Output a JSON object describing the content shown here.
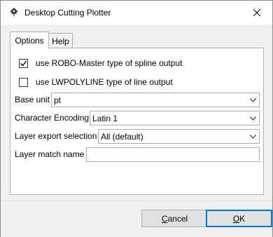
{
  "window": {
    "title": "Desktop Cutting Plotter"
  },
  "tabs": [
    {
      "label": "Options",
      "active": true
    },
    {
      "label": "Help",
      "active": false
    }
  ],
  "options": {
    "robo_master": {
      "label": "use ROBO-Master type of spline output",
      "checked": true
    },
    "lwpolyline": {
      "label": "use LWPOLYLINE type of line output",
      "checked": false
    },
    "base_unit": {
      "label": "Base unit",
      "value": "pt"
    },
    "character_encoding": {
      "label": "Character Encoding",
      "value": "Latin 1"
    },
    "layer_export": {
      "label": "Layer export selection",
      "value": "All (default)"
    },
    "layer_match": {
      "label": "Layer match name",
      "value": ""
    }
  },
  "buttons": {
    "cancel": {
      "first": "C",
      "rest": "ancel"
    },
    "ok": {
      "first": "O",
      "rest": "K"
    }
  },
  "colors": {
    "default_button_border": "#0078d7",
    "dialog_background": "#f0f0f0"
  }
}
